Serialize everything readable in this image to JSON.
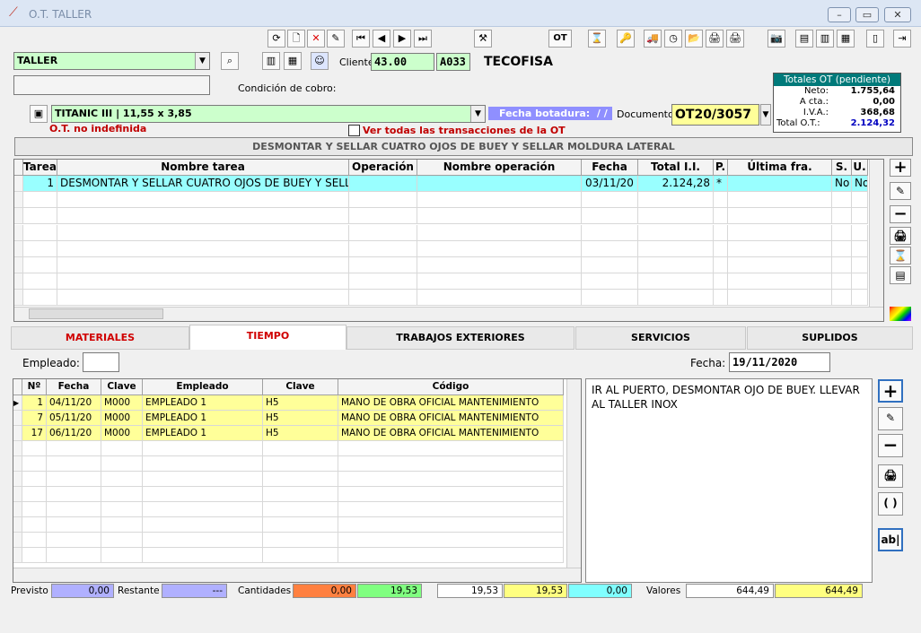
{
  "window": {
    "title": "O.T. TALLER",
    "min": "–",
    "max": "▭",
    "close": "✕"
  },
  "toolbar1": [
    "⟳",
    "🗋",
    "✕",
    "✎",
    "⏮",
    "◀",
    "▶",
    "⏭",
    "⚒",
    "OT",
    "⌛",
    "🔑",
    "🚚",
    "◷",
    "📂",
    "🖨",
    "🖨",
    "📷",
    "▤",
    "▥",
    "▦",
    "▯",
    "⇥"
  ],
  "header": {
    "section": "TALLER",
    "cliente_label": "Cliente:",
    "cliente_code": "43.00",
    "cliente_sub": "A033",
    "cliente_name": "TECOFISA",
    "condicion_label": "Condición de cobro:",
    "vessel": "TITANIC III | 11,55 x 3,85",
    "fecha_botadura_label": "Fecha botadura:",
    "fecha_botadura_value": "/ /",
    "documento_label": "Documento:",
    "documento_value": "OT20/3057",
    "ot_status": "O.T. no indefinida",
    "ver_todas": "Ver todas las transacciones de la OT",
    "description": "DESMONTAR Y SELLAR CUATRO OJOS DE BUEY Y SELLAR MOLDURA LATERAL"
  },
  "totales": {
    "title": "Totales OT (pendiente)",
    "rows": [
      {
        "label": "Neto:",
        "value": "1.755,64"
      },
      {
        "label": "A cta.:",
        "value": "0,00"
      },
      {
        "label": "I.V.A.:",
        "value": "368,68"
      },
      {
        "label": "Total O.T.:",
        "value": "2.124,32"
      }
    ]
  },
  "tasks": {
    "headers": [
      "Tarea",
      "Nombre tarea",
      "Operación",
      "Nombre operación",
      "Fecha",
      "Total I.I.",
      "P.",
      "Última fra.",
      "S.",
      "U."
    ],
    "rows": [
      [
        "1",
        "DESMONTAR Y SELLAR CUATRO OJOS DE BUEY Y SELLA",
        "",
        "",
        "03/11/20",
        "2.124,28",
        "*",
        "",
        "No",
        "No"
      ]
    ]
  },
  "side_buttons": [
    "+",
    "✎",
    "−",
    "🖨",
    "⌛",
    "▤"
  ],
  "tabs": [
    "MATERIALES",
    "TIEMPO",
    "TRABAJOS EXTERIORES",
    "SERVICIOS",
    "SUPLIDOS"
  ],
  "tiempo": {
    "empleado_label": "Empleado:",
    "fecha_label": "Fecha:",
    "fecha_value": "19/11/2020",
    "headers": [
      "Nº",
      "Fecha",
      "Clave",
      "Empleado",
      "Clave",
      "Código"
    ],
    "rows": [
      [
        "1",
        "04/11/20",
        "M000",
        "EMPLEADO 1",
        "H5",
        "MANO DE OBRA OFICIAL MANTENIMIENTO"
      ],
      [
        "7",
        "05/11/20",
        "M000",
        "EMPLEADO 1",
        "H5",
        "MANO DE OBRA OFICIAL MANTENIMIENTO"
      ],
      [
        "17",
        "06/11/20",
        "M000",
        "EMPLEADO 1",
        "H5",
        "MANO DE OBRA OFICIAL MANTENIMIENTO"
      ]
    ],
    "note": "IR AL PUERTO, DESMONTAR OJO DE BUEY. LLEVAR AL TALLER INOX"
  },
  "side_buttons2": [
    "+",
    "✎",
    "−",
    "🖨",
    "( )",
    "ab|"
  ],
  "footer": {
    "previsto_label": "Previsto",
    "previsto": "0,00",
    "restante_label": "Restante",
    "restante": "---",
    "cantidades_label": "Cantidades",
    "c1": "0,00",
    "c2": "19,53",
    "c3": "19,53",
    "c4": "19,53",
    "c5": "0,00",
    "valores_label": "Valores",
    "v1": "644,49",
    "v2": "644,49"
  }
}
